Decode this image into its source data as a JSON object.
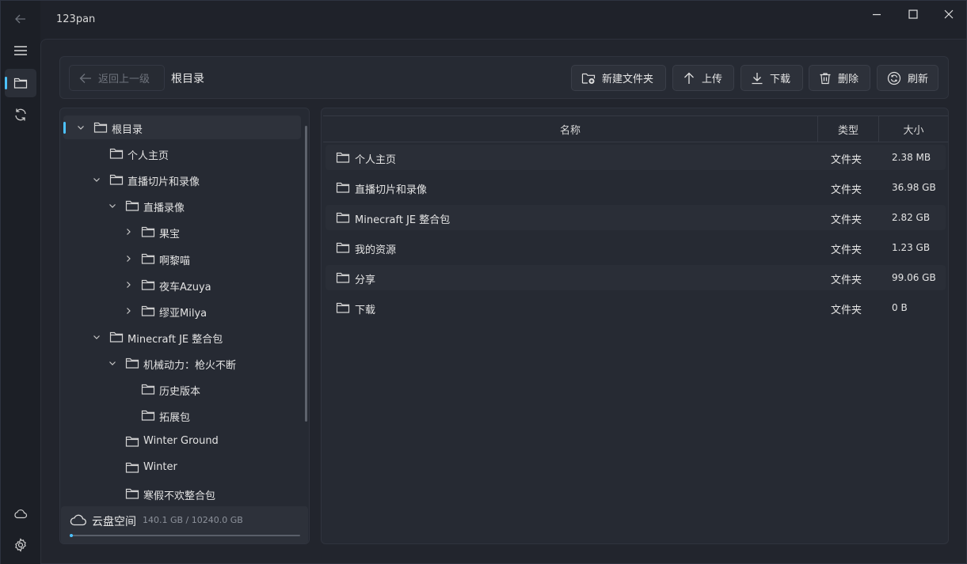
{
  "app": {
    "title": "123pan"
  },
  "toolbar": {
    "back_label": "返回上一级",
    "breadcrumb": "根目录",
    "new_folder_label": "新建文件夹",
    "upload_label": "上传",
    "download_label": "下载",
    "delete_label": "删除",
    "refresh_label": "刷新"
  },
  "tree": [
    {
      "label": "根目录",
      "expanded": true
    },
    {
      "label": "个人主页"
    },
    {
      "label": "直播切片和录像",
      "expanded": true
    },
    {
      "label": "直播录像",
      "expanded": true
    },
    {
      "label": "果宝",
      "expanded": false
    },
    {
      "label": "啊黎喵",
      "expanded": false
    },
    {
      "label": "夜车Azuya",
      "expanded": false
    },
    {
      "label": "缪亚Milya",
      "expanded": false
    },
    {
      "label": "Minecraft JE 整合包",
      "expanded": true
    },
    {
      "label": "机械动力：枪火不断",
      "expanded": true
    },
    {
      "label": "历史版本"
    },
    {
      "label": "拓展包"
    },
    {
      "label": "Winter Ground"
    },
    {
      "label": "Winter"
    },
    {
      "label": "寒假不欢整合包"
    }
  ],
  "storage": {
    "label": "云盘空间",
    "value": "140.1 GB / 10240.0 GB",
    "used_fraction": 0.0137
  },
  "list": {
    "columns": {
      "name": "名称",
      "type": "类型",
      "size": "大小"
    },
    "rows": [
      {
        "name": "个人主页",
        "type": "文件夹",
        "size": "2.38 MB"
      },
      {
        "name": "直播切片和录像",
        "type": "文件夹",
        "size": "36.98 GB"
      },
      {
        "name": "Minecraft JE 整合包",
        "type": "文件夹",
        "size": "2.82 GB"
      },
      {
        "name": "我的资源",
        "type": "文件夹",
        "size": "1.23 GB"
      },
      {
        "name": "分享",
        "type": "文件夹",
        "size": "99.06 GB"
      },
      {
        "name": "下载",
        "type": "文件夹",
        "size": "0 B"
      }
    ]
  },
  "colors": {
    "accent": "#4cc2ff",
    "background": "#1f222a",
    "panel": "#262a33"
  }
}
